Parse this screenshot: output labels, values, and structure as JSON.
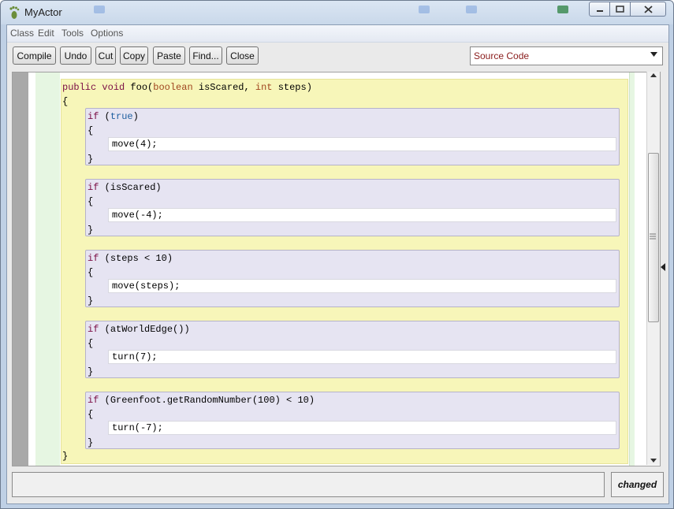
{
  "window": {
    "title": "MyActor"
  },
  "menu": {
    "items": [
      "Class",
      "Edit",
      "Tools",
      "Options"
    ]
  },
  "toolbar": {
    "buttons": [
      "Compile",
      "Undo",
      "Cut",
      "Copy",
      "Paste",
      "Find...",
      "Close"
    ],
    "view_select": {
      "value": "Source Code"
    }
  },
  "code": {
    "sig_public": "public",
    "sig_void": "void",
    "sig_name": " foo(",
    "sig_boolean": "boolean",
    "sig_param1": " isScared, ",
    "sig_int": "int",
    "sig_param2": " steps)",
    "open_brace": "{",
    "close_brace": "}",
    "if_keyword": "if",
    "blocks": [
      {
        "cond_pre": " (",
        "cond": "true",
        "cond_post": ")",
        "body": "move(4);",
        "lit": true
      },
      {
        "cond_pre": " (",
        "cond": "isScared",
        "cond_post": ")",
        "body": "move(-4);",
        "lit": false
      },
      {
        "cond_pre": " (",
        "cond": "steps < 10",
        "cond_post": ")",
        "body": "move(steps);",
        "lit": false
      },
      {
        "cond_pre": " (",
        "cond": "atWorldEdge()",
        "cond_post": ")",
        "body": "turn(7);",
        "lit": false
      },
      {
        "cond_pre": " (",
        "cond": "Greenfoot.getRandomNumber(100) < 10",
        "cond_post": ")",
        "body": "turn(-7);",
        "lit": false
      }
    ]
  },
  "status": {
    "message": "",
    "state": "changed"
  },
  "icons": [
    "foot-icon",
    "minimize-icon",
    "maximize-icon",
    "close-icon",
    "chevron-down-icon",
    "scroll-up-icon",
    "scroll-down-icon",
    "collapse-arrow-icon"
  ]
}
